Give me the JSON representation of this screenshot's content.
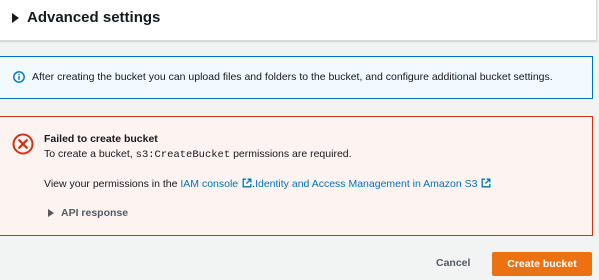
{
  "advanced_settings": {
    "title": "Advanced settings"
  },
  "info_alert": {
    "icon": "info-icon",
    "text": "After creating the bucket you can upload files and folders to the bucket, and configure additional bucket settings."
  },
  "error_alert": {
    "icon": "error-icon",
    "title": "Failed to create bucket",
    "desc_prefix": "To create a bucket, ",
    "desc_code": "s3:CreateBucket",
    "desc_suffix": " permissions are required.",
    "perm_prefix": "View your permissions in the ",
    "iam_link": "IAM console",
    "separator": ". ",
    "iam_s3_link": "Identity and Access Management in Amazon S3",
    "api_response_label": "API response"
  },
  "footer": {
    "cancel_label": "Cancel",
    "create_label": "Create bucket"
  },
  "colors": {
    "background": "#f2f3f3",
    "info_border": "#0073bb",
    "info_bg": "#f1faff",
    "error_border": "#d13212",
    "error_bg": "#fdf3f1",
    "link": "#0073bb",
    "primary_button": "#ec7211"
  }
}
